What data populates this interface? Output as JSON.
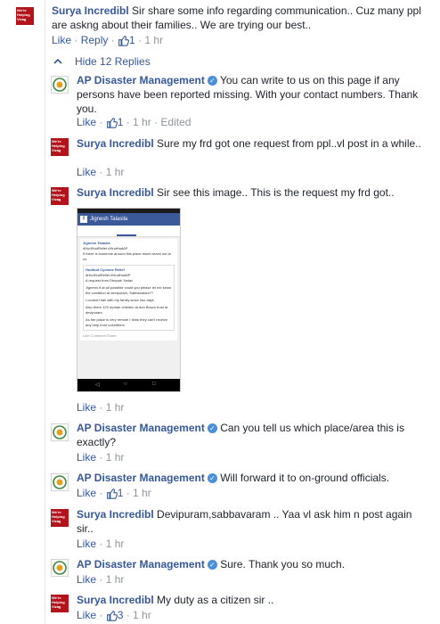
{
  "comments": [
    {
      "author": "Surya Incredibl",
      "text": "Sir share some info regarding communication.. Cuz many ppl are askng about their families.. We are trying our best..",
      "like": "Like",
      "reply": "Reply",
      "likes": "1",
      "time": "1 hr"
    },
    {
      "author": "AP Disaster Management",
      "verified": true,
      "text": "You can write to us on this page if any persons have been reported missing. With your contact numbers. Thank you.",
      "like": "Like",
      "likes": "1",
      "time": "1 hr",
      "edited": "Edited"
    },
    {
      "author": "Surya Incredibl",
      "text": "Sure my frd got one request from ppl..vl post in a while..",
      "like": "Like",
      "time": "1 hr"
    },
    {
      "author": "Surya Incredibl",
      "text": "Sir see this image.. This is the request my frd got..",
      "like": "Like",
      "time": "1 hr"
    },
    {
      "author": "AP Disaster Management",
      "verified": true,
      "text": "Can you tell us which place/area this is exactly?",
      "like": "Like",
      "time": "1 hr"
    },
    {
      "author": "AP Disaster Management",
      "verified": true,
      "text": "Will forward it to on-ground officials.",
      "like": "Like",
      "likes": "1",
      "time": "1 hr"
    },
    {
      "author": "Surya Incredibl",
      "text": "Devipuram,sabbavaram .. Yaa vl ask him n post again sir..",
      "like": "Like",
      "time": "1 hr"
    },
    {
      "author": "AP Disaster Management",
      "verified": true,
      "text": "Sure. Thank you so much.",
      "like": "Like",
      "time": "1 hr"
    },
    {
      "author": "Surya Incredibl",
      "text": "My duty as a citizen sir ..",
      "like": "Like",
      "likes": "3",
      "time": "1 hr"
    }
  ],
  "hide_replies": "Hide 12 Replies",
  "avatar_surya_text": "We're Helping Vizag",
  "attached_image": {
    "title": "Jignesh Talasila",
    "post_author": "Jignesh Talasila",
    "post_line1": "#HudHudRelief #HudHudAP",
    "post_line2": "If there is someone around this place reach reach out to us",
    "shared_page": "Hudhud Cyclone Relief",
    "shared_tags": "#HudHudRelief #HudHudAP",
    "shared_from": "A request from Deepak Yadav",
    "body1": "Jignesh If at all possible could you please let me know the condition at devipuram, Sabbavaram??",
    "body2": "I couldn't talk with my family since two days",
    "body3": "Also there 120 orphan children at don Bosco trust at devipuram",
    "body4": "As the place is very remote I think they can't receive any help from volunteers",
    "actions": "Like   Comment   Share"
  },
  "colors": {
    "link": "#365899",
    "meta": "#90949c",
    "avatar_red": "#b3141b",
    "verified": "#4a90d9"
  }
}
